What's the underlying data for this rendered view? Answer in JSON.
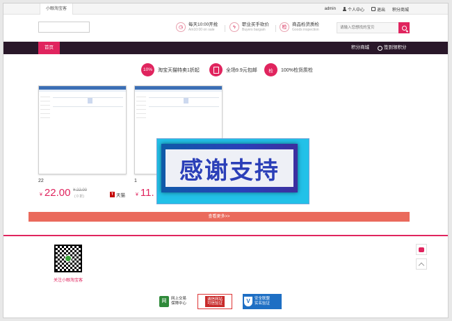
{
  "top": {
    "site_tab": "小眼淘宝客",
    "user": "admin",
    "profile": "个人中心",
    "logout": "退出",
    "mall": "积分商城"
  },
  "header": {
    "promos": [
      {
        "title": "每天10:00开抢",
        "sub": "Am10:00 on sale"
      },
      {
        "title": "职业买手砍价",
        "sub": "Buyers bargain"
      },
      {
        "title": "商品检货质检",
        "sub": "Goods inspection",
        "icon_text": "检"
      }
    ],
    "search_placeholder": "请输入您想找的宝贝"
  },
  "nav": {
    "home": "首页",
    "points_mall": "积分商城",
    "checkin": "签到领积分"
  },
  "features": [
    {
      "icon_text": "10%",
      "label": "淘宝天猫特卖1折起"
    },
    {
      "icon_text": "",
      "label": "全场9.9元包邮"
    },
    {
      "icon_text": "检",
      "label": "100%检货质检"
    }
  ],
  "products": [
    {
      "name": "22",
      "currency": "¥",
      "price": "22.00",
      "orig_price": "¥ 22.00",
      "sales": "( 0 折)",
      "platform": "天猫",
      "platform_badge": "T"
    },
    {
      "name": "1",
      "currency": "¥",
      "price": "11."
    }
  ],
  "overlay_text": "感谢支持",
  "more_label": "查看更多>>",
  "footer": {
    "qr_caption": "关注小眼淘宝客",
    "badges": [
      {
        "icon": "网",
        "line1": "网上交易",
        "line2": "保障中心"
      },
      {
        "line1": "诚信网站",
        "line2": "可信验证"
      },
      {
        "icon": "V",
        "line1": "安全联盟",
        "line2": "实名验证"
      }
    ]
  },
  "colors": {
    "accent": "#e0245e",
    "nav_bg": "#291729",
    "more_btn": "#ea6a5c"
  }
}
